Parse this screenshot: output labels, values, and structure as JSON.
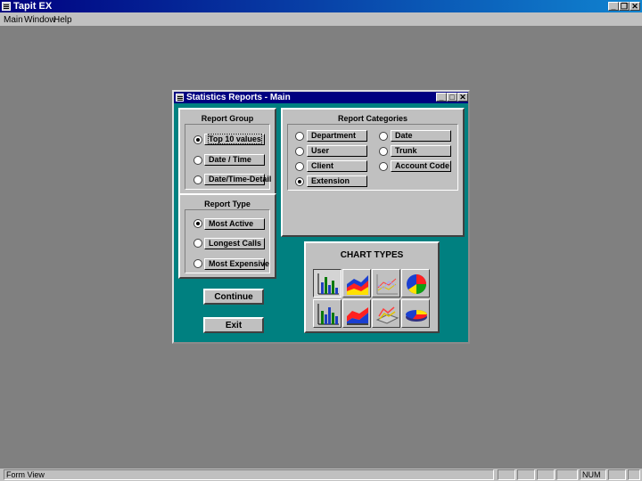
{
  "app": {
    "title": "Tapit EX",
    "minimize": "_",
    "restore": "❐",
    "close": "✕"
  },
  "menu": {
    "items": [
      "Main",
      "Window",
      "Help"
    ]
  },
  "status": {
    "left_text": "Form View",
    "num": "NUM"
  },
  "dialog": {
    "title": "Statistics Reports -  Main",
    "report_group": {
      "title": "Report Group",
      "options": [
        "Top 10 values",
        "Date / Time",
        "Date/Time-Detail"
      ],
      "selected": 0
    },
    "report_type": {
      "title": "Report Type",
      "options": [
        "Most Active",
        "Longest Calls",
        "Most Expensive"
      ],
      "selected": 0
    },
    "report_categories": {
      "title": "Report Categories",
      "left_options": [
        "Department",
        "User",
        "Client",
        "Extension"
      ],
      "right_options": [
        "Date",
        "Trunk",
        "Account Code"
      ],
      "selected": "Extension"
    },
    "chart_types": {
      "title": "CHART TYPES",
      "icons": [
        "bar-chart-icon",
        "area-chart-icon",
        "line-chart-icon",
        "pie-chart-icon",
        "bar-3d-chart-icon",
        "area-3d-chart-icon",
        "line-3d-chart-icon",
        "pie-3d-chart-icon"
      ],
      "selected": 0
    },
    "continue_label": "Continue",
    "exit_label": "Exit"
  },
  "colors": {
    "desktop": "#808080",
    "dialog_bg": "#008080",
    "titlebar": "#000080",
    "face": "#c0c0c0"
  }
}
